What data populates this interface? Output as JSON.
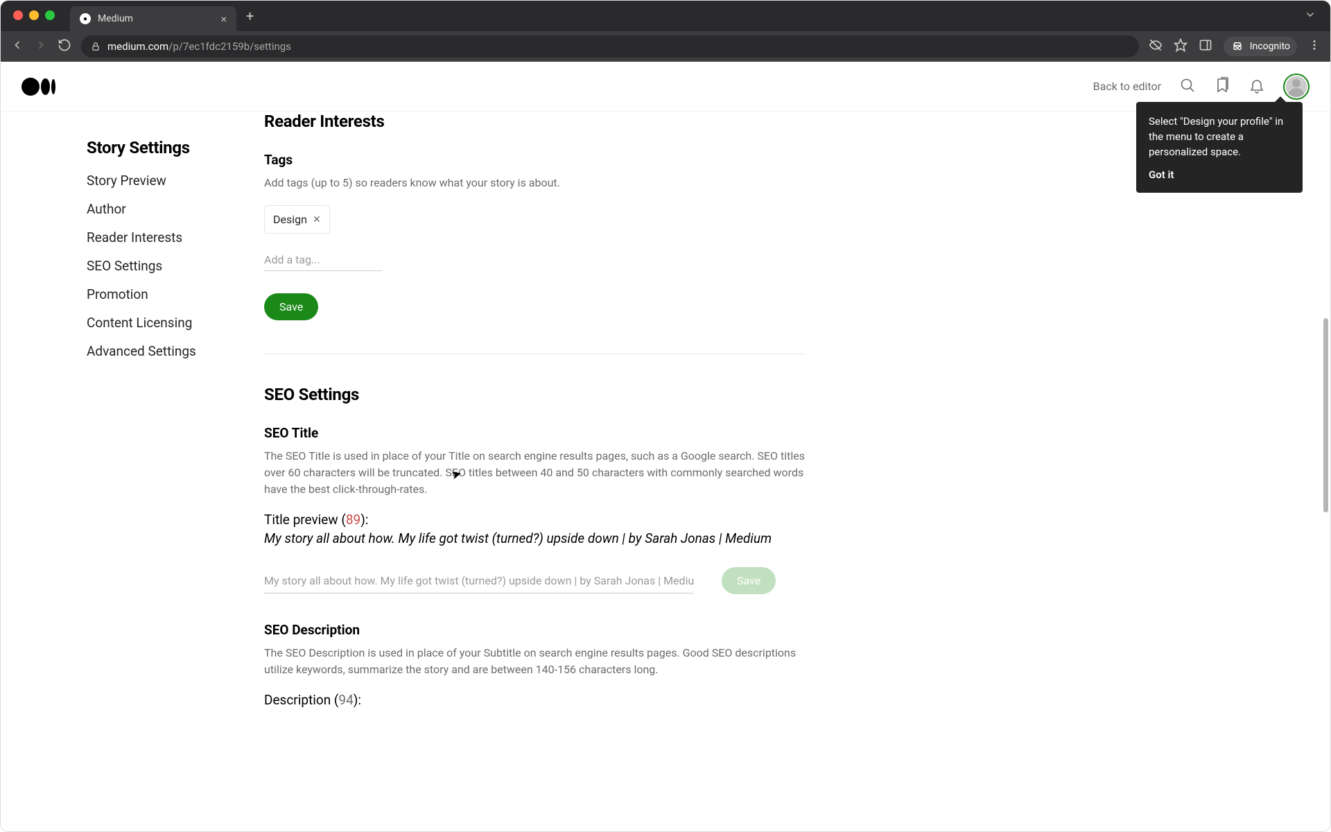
{
  "browser": {
    "tab_title": "Medium",
    "url_domain": "medium.com",
    "url_path": "/p/7ec1fdc2159b/settings",
    "incognito_label": "Incognito"
  },
  "header": {
    "back_to_editor": "Back to editor"
  },
  "tooltip": {
    "text": "Select \"Design your profile\" in the menu to create a personalized space.",
    "button": "Got it"
  },
  "sidebar": {
    "title": "Story Settings",
    "items": [
      "Story Preview",
      "Author",
      "Reader Interests",
      "SEO Settings",
      "Promotion",
      "Content Licensing",
      "Advanced Settings"
    ]
  },
  "reader_interests": {
    "title": "Reader Interests",
    "tags_heading": "Tags",
    "tags_desc": "Add tags (up to 5) so readers know what your story is about.",
    "tag_chip": "Design",
    "tag_input_placeholder": "Add a tag...",
    "save_label": "Save"
  },
  "seo": {
    "title": "SEO Settings",
    "seo_title_heading": "SEO Title",
    "seo_title_desc": "The SEO Title is used in place of your Title on search engine results pages, such as a Google search. SEO titles over 60 characters will be truncated. SEO titles between 40 and 50 characters with commonly searched words have the best click-through-rates.",
    "title_preview_label": "Title preview (",
    "title_preview_count": "89",
    "title_preview_close": "):",
    "title_preview_text": "My story all about how. My life got twist (turned?) upside down | by Sarah Jonas | Medium",
    "seo_title_placeholder": "My story all about how. My life got twist (turned?) upside down | by Sarah Jonas | Medium",
    "save_label": "Save",
    "seo_desc_heading": "SEO Description",
    "seo_desc_text": "The SEO Description is used in place of your Subtitle on search engine results pages. Good SEO descriptions utilize keywords, summarize the story and are between 140-156 characters long.",
    "desc_preview_label": "Description (",
    "desc_preview_count": "94",
    "desc_preview_close": "):"
  }
}
